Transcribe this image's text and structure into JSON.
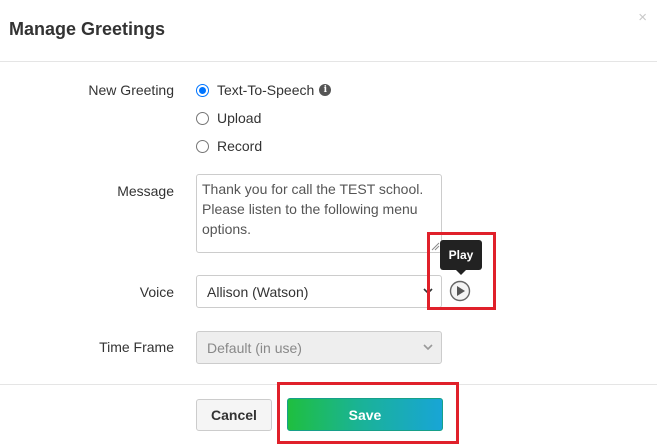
{
  "modal": {
    "title": "Manage Greetings",
    "close_glyph": "×"
  },
  "form": {
    "new_greeting_label": "New Greeting",
    "options": [
      {
        "label": "Text-To-Speech",
        "checked": true
      },
      {
        "label": "Upload",
        "checked": false
      },
      {
        "label": "Record",
        "checked": false
      }
    ],
    "info_glyph": "i",
    "message_label": "Message",
    "message_value": "Thank you for call the TEST school. Please listen to the following menu options.",
    "voice_label": "Voice",
    "voice_value": "Allison (Watson)",
    "play_tooltip": "Play",
    "time_frame_label": "Time Frame",
    "time_frame_value": "Default (in use)"
  },
  "footer": {
    "cancel_label": "Cancel",
    "save_label": "Save"
  },
  "colors": {
    "highlight": "#e0202a",
    "radio_accent": "#0075ff",
    "save_gradient_start": "#1fbf3f",
    "save_gradient_end": "#18a5d6"
  },
  "icons": [
    "info-icon",
    "close-icon",
    "play-icon",
    "chevron-down-icon",
    "resize-grip-icon"
  ]
}
